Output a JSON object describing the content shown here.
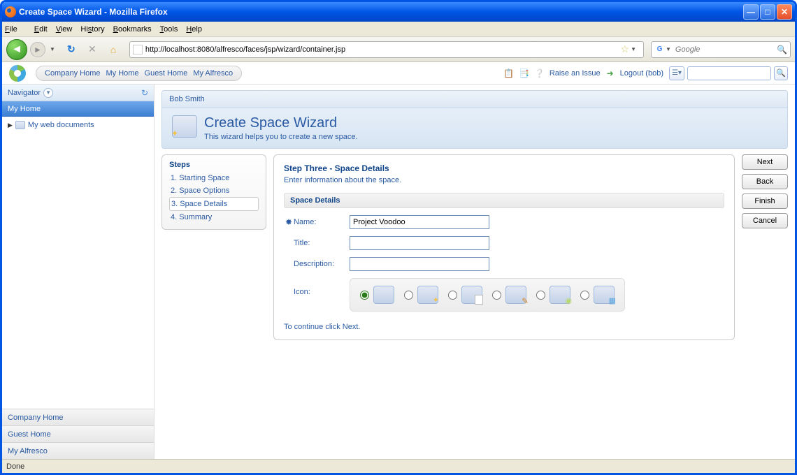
{
  "window": {
    "title": "Create Space Wizard - Mozilla Firefox"
  },
  "menubar": {
    "file": "File",
    "edit": "Edit",
    "view": "View",
    "history": "History",
    "bookmarks": "Bookmarks",
    "tools": "Tools",
    "help": "Help"
  },
  "navbar": {
    "url": "http://localhost:8080/alfresco/faces/jsp/wizard/container.jsp",
    "search_placeholder": "Google"
  },
  "alf_top": {
    "nav": [
      "Company Home",
      "My Home",
      "Guest Home",
      "My Alfresco"
    ],
    "raise_issue": "Raise an Issue",
    "logout": "Logout (bob)"
  },
  "sidebar": {
    "header": "Navigator",
    "selected": "My Home",
    "tree_item": "My web documents",
    "links": [
      "Company Home",
      "Guest Home",
      "My Alfresco"
    ]
  },
  "breadcrumb": "Bob Smith",
  "wizard": {
    "title": "Create Space Wizard",
    "subtitle": "This wizard helps you to create a new space."
  },
  "steps": {
    "heading": "Steps",
    "items": [
      "1. Starting Space",
      "2. Space Options",
      "3. Space Details",
      "4. Summary"
    ],
    "active_index": 2
  },
  "form": {
    "step_title": "Step Three - Space Details",
    "step_desc": "Enter information about the space.",
    "section": "Space Details",
    "labels": {
      "name": "Name:",
      "title": "Title:",
      "description": "Description:",
      "icon": "Icon:"
    },
    "values": {
      "name": "Project Voodoo",
      "title": "",
      "description": ""
    },
    "continue": "To continue click Next."
  },
  "actions": {
    "next": "Next",
    "back": "Back",
    "finish": "Finish",
    "cancel": "Cancel"
  },
  "statusbar": {
    "text": "Done"
  }
}
